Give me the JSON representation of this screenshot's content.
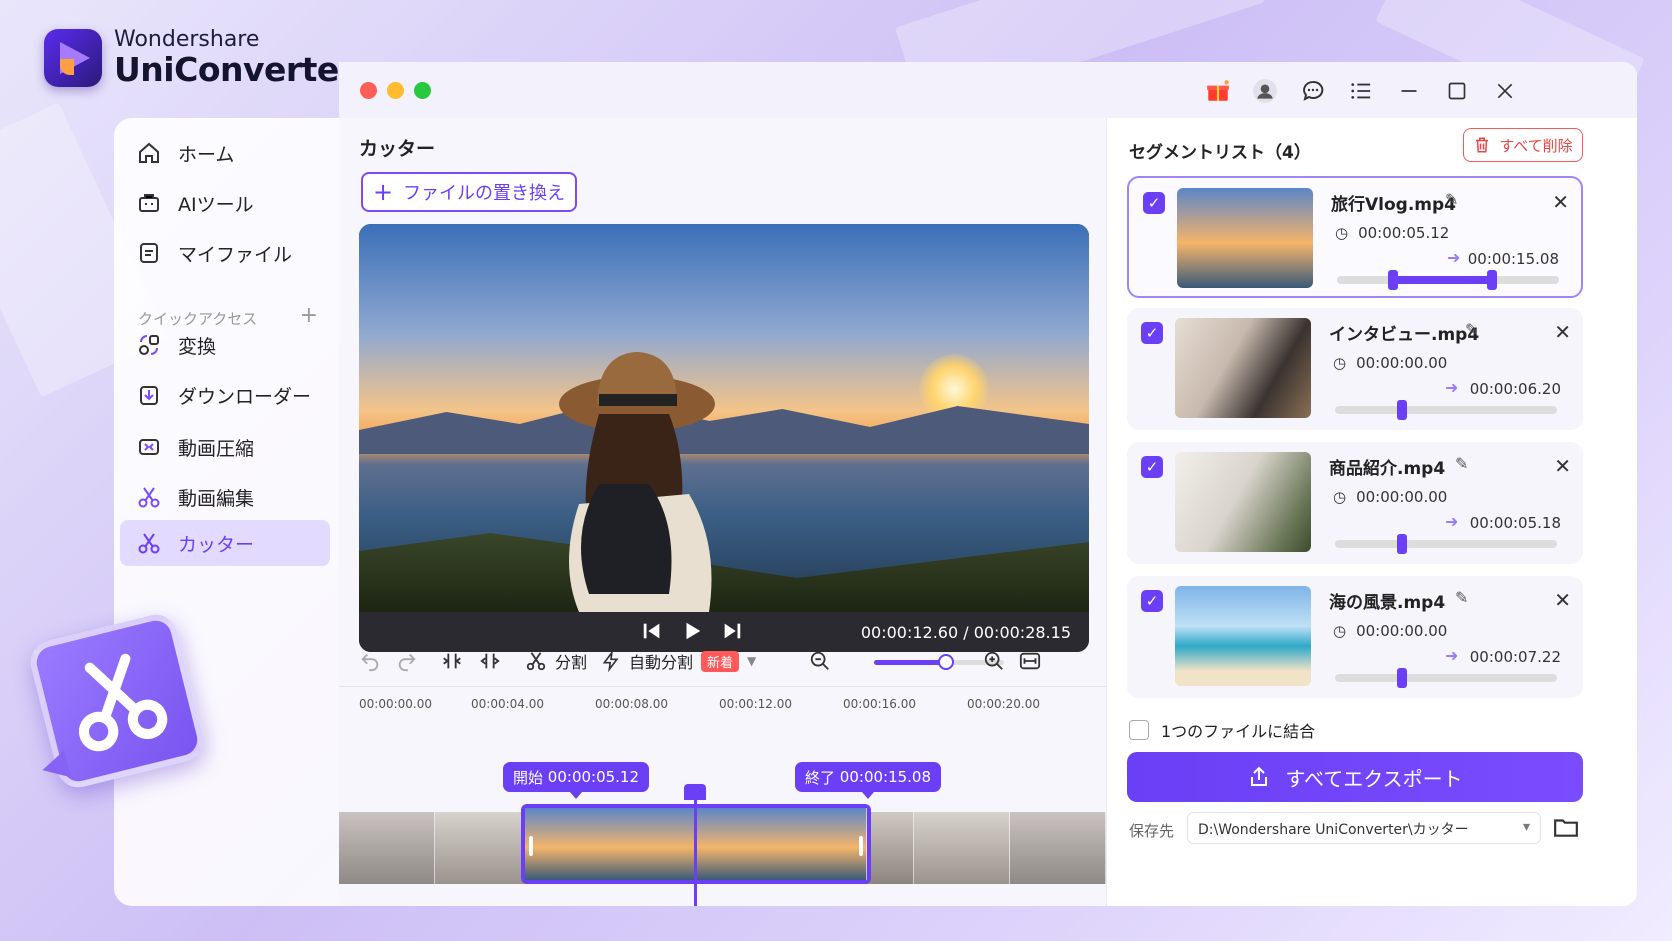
{
  "brand": {
    "line1": "Wondershare",
    "line2": "UniConverter"
  },
  "sidebar": {
    "items": [
      {
        "label": "ホーム",
        "icon": "home-icon"
      },
      {
        "label": "AIツール",
        "icon": "ai-toolbox-icon"
      },
      {
        "label": "マイファイル",
        "icon": "file-icon"
      }
    ],
    "quick_access_label": "クイックアクセス",
    "quick_items": [
      {
        "label": "変換",
        "icon": "convert-icon"
      },
      {
        "label": "ダウンローダー",
        "icon": "download-icon"
      },
      {
        "label": "動画圧縮",
        "icon": "compress-icon"
      },
      {
        "label": "動画編集",
        "icon": "edit-video-icon"
      },
      {
        "label": "カッター",
        "icon": "scissors-icon",
        "active": true
      }
    ]
  },
  "main": {
    "title": "カッター",
    "replace_label": "ファイルの置き換え",
    "timecode": "00:00:12.60 / 00:00:28.15",
    "toolbar": {
      "split_label": "分割",
      "auto_split_label": "自動分割",
      "new_badge": "新着",
      "zoom_level": 0.55
    },
    "ruler": [
      "00:00:00.00",
      "00:00:04.00",
      "00:00:08.00",
      "00:00:12.00",
      "00:00:16.00",
      "00:00:20.00"
    ],
    "start_flag": {
      "label": "開始",
      "time": "00:00:05.12"
    },
    "end_flag": {
      "label": "終了",
      "time": "00:00:15.08"
    }
  },
  "segments": {
    "title": "セグメントリスト（4）",
    "delete_all": "すべて削除",
    "items": [
      {
        "name": "旅行Vlog.mp4",
        "start": "00:00:05.12",
        "end": "00:00:15.08",
        "range": [
          0.25,
          0.7
        ],
        "selected": true
      },
      {
        "name": "インタビュー.mp4",
        "start": "00:00:00.00",
        "end": "00:00:06.20",
        "range": [
          0.3,
          0.3
        ],
        "selected": false
      },
      {
        "name": "商品紹介.mp4",
        "start": "00:00:00.00",
        "end": "00:00:05.18",
        "range": [
          0.3,
          0.3
        ],
        "selected": false
      },
      {
        "name": "海の風景.mp4",
        "start": "00:00:00.00",
        "end": "00:00:07.22",
        "range": [
          0.3,
          0.3
        ],
        "selected": false
      }
    ],
    "merge_label": "1つのファイルに結合",
    "export_label": "すべてエクスポート",
    "save_label": "保存先",
    "save_path": "D:\\Wondershare UniConverter\\カッター"
  },
  "colors": {
    "accent": "#6a3ff5",
    "danger": "#e84545"
  }
}
